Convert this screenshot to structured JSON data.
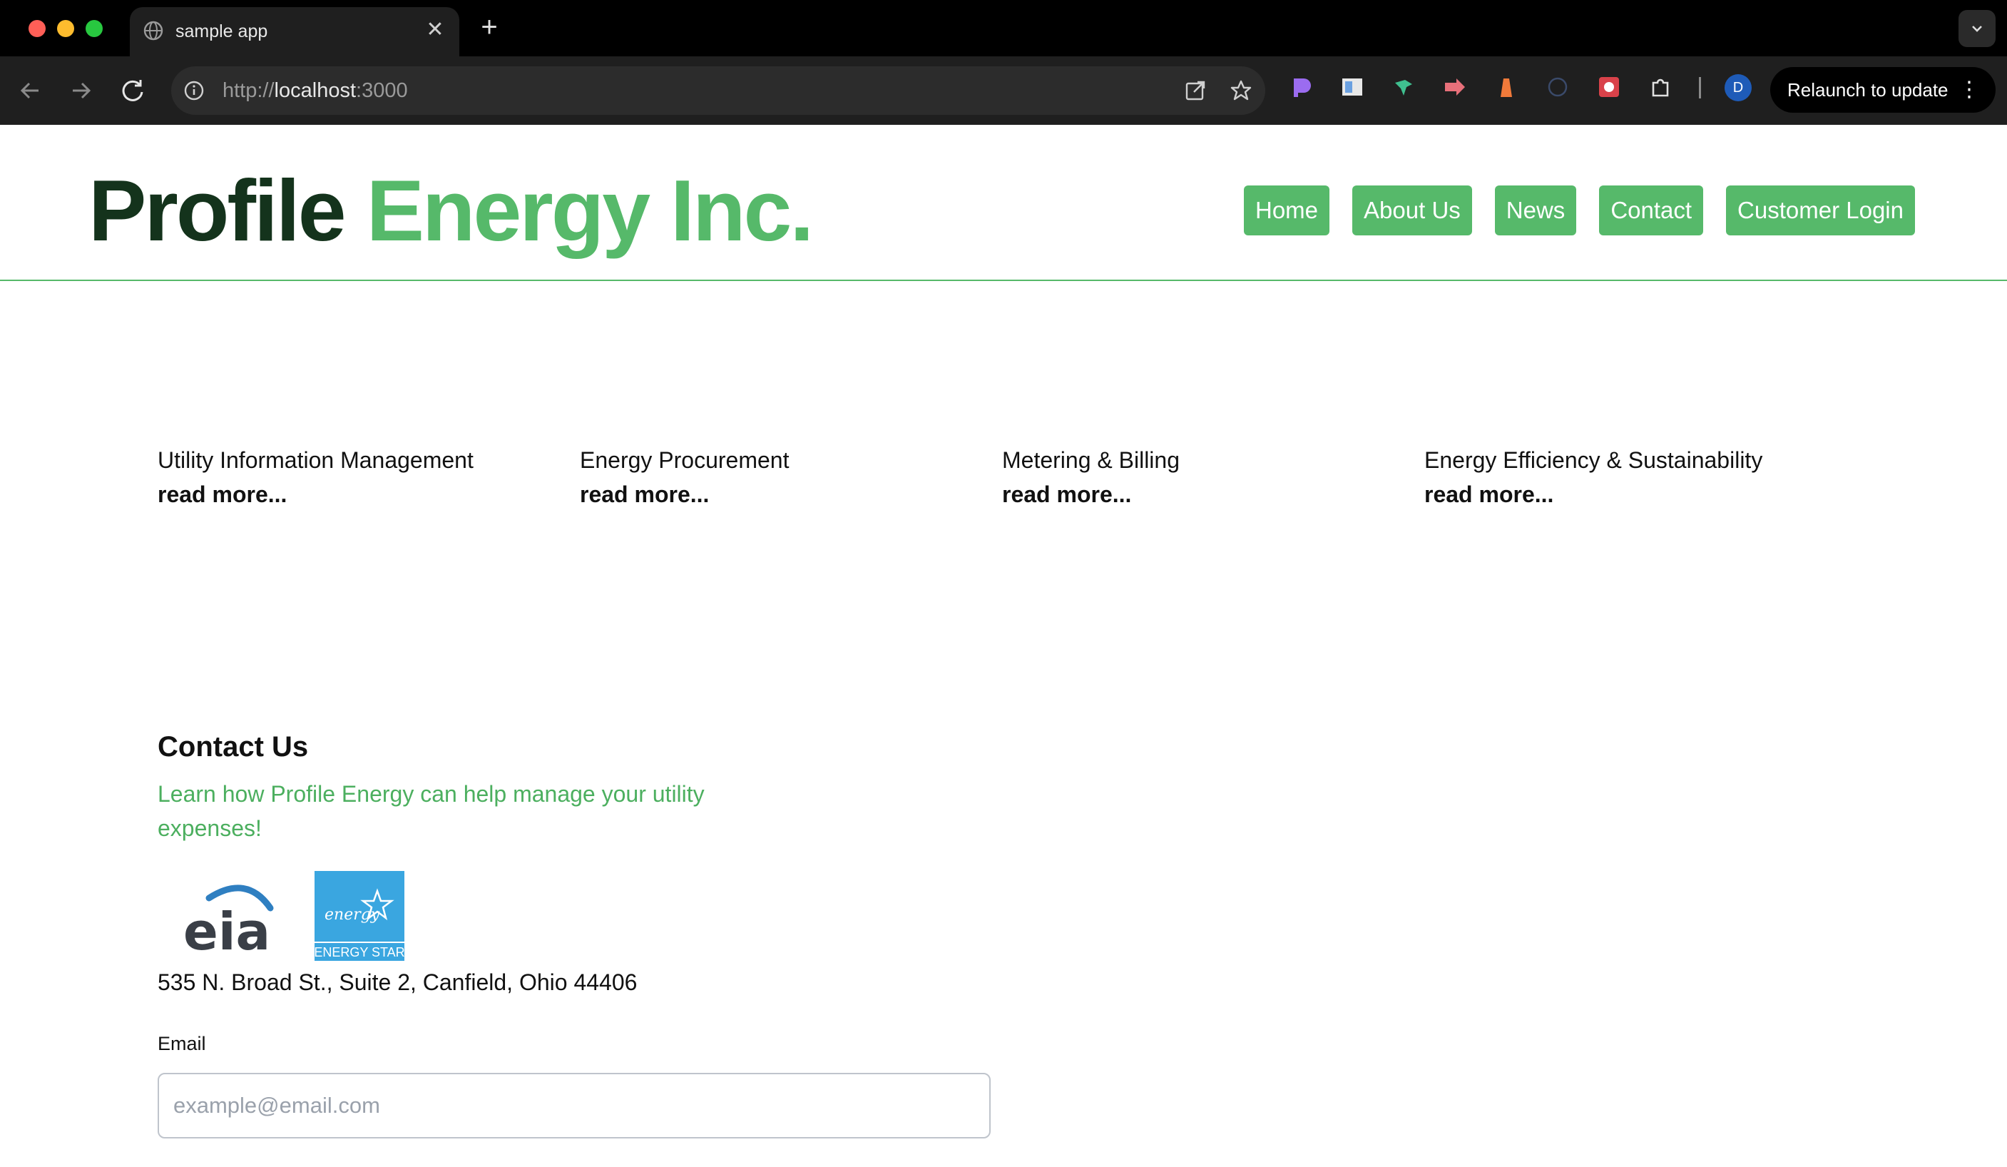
{
  "browser": {
    "tab_title": "sample app",
    "url_scheme": "http://",
    "url_host": "localhost",
    "url_port": ":3000",
    "relaunch_label": "Relaunch to update",
    "profile_initial": "D",
    "new_tab_glyph": "+",
    "close_glyph": "✕",
    "icons": [
      "globe-icon",
      "back-arrow-icon",
      "forward-arrow-icon",
      "reload-icon",
      "site-info-icon",
      "open-in-app-icon",
      "bookmark-star-icon",
      "extensions-puzzle-icon",
      "kebab-menu-icon",
      "tab-list-chevron-icon"
    ]
  },
  "site": {
    "logo_part1": "Profile",
    "logo_part2": "Energy Inc.",
    "colors": {
      "brand_green": "#56b96a",
      "brand_dark": "#14331c",
      "link_green": "#4caf5f"
    },
    "nav": [
      {
        "label": "Home"
      },
      {
        "label": "About Us"
      },
      {
        "label": "News"
      },
      {
        "label": "Contact"
      },
      {
        "label": "Customer Login"
      }
    ]
  },
  "services": [
    {
      "title": "Utility Information Management",
      "more": "read more..."
    },
    {
      "title": "Energy Procurement",
      "more": "read more..."
    },
    {
      "title": "Metering & Billing",
      "more": "read more..."
    },
    {
      "title": "Energy Efficiency & Sustainability",
      "more": "read more..."
    }
  ],
  "contact": {
    "title": "Contact Us",
    "tagline": "Learn how Profile Energy can help manage your utility expenses!",
    "logo_eia_text": "eia",
    "logo_energystar_caption": "ENERGY STAR",
    "logo_energystar_script": "energy",
    "address": "535 N. Broad St., Suite 2, Canfield, Ohio 44406",
    "email_label": "Email",
    "email_placeholder": "example@email.com",
    "email_value": ""
  }
}
